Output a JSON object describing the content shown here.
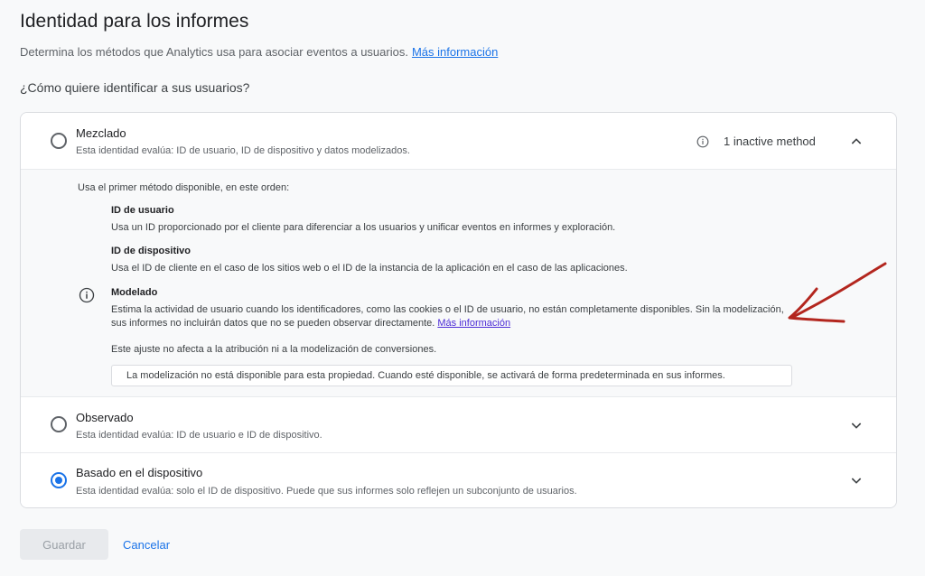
{
  "header": {
    "title": "Identidad para los informes",
    "subtitle": "Determina los métodos que Analytics usa para asociar eventos a usuarios.",
    "learn_more": "Más información",
    "question": "¿Cómo quiere identificar a sus usuarios?"
  },
  "options": {
    "blended": {
      "title": "Mezclado",
      "description": "Esta identidad evalúa: ID de usuario, ID de dispositivo y datos modelizados.",
      "status": "1 inactive method",
      "selected": false
    },
    "observed": {
      "title": "Observado",
      "description": "Esta identidad evalúa: ID de usuario e ID de dispositivo.",
      "selected": false
    },
    "device": {
      "title": "Basado en el dispositivo",
      "description": "Esta identidad evalúa: solo el ID de dispositivo. Puede que sus informes solo reflejen un subconjunto de usuarios.",
      "selected": true
    }
  },
  "details": {
    "intro": "Usa el primer método disponible, en este orden:",
    "methods": [
      {
        "title": "ID de usuario",
        "description": "Usa un ID proporcionado por el cliente para diferenciar a los usuarios y unificar eventos en informes y exploración."
      },
      {
        "title": "ID de dispositivo",
        "description": "Usa el ID de cliente en el caso de los sitios web o el ID de la instancia de la aplicación en el caso de las aplicaciones."
      },
      {
        "title": "Modelado",
        "description": "Estima la actividad de usuario cuando los identificadores, como las cookies o el ID de usuario, no están completamente disponibles. Sin la modelización, sus informes no incluirán datos que no se pueden observar directamente.",
        "learn_more": "Más información"
      }
    ],
    "attribution_note": "Este ajuste no afecta a la atribución ni a la modelización de conversiones.",
    "availability_note": "La modelización no está disponible para esta propiedad. Cuando esté disponible, se activará de forma predeterminada en sus informes."
  },
  "actions": {
    "save": "Guardar",
    "cancel": "Cancelar"
  },
  "colors": {
    "accent": "#1a73e8",
    "annotation": "#b3261e"
  }
}
